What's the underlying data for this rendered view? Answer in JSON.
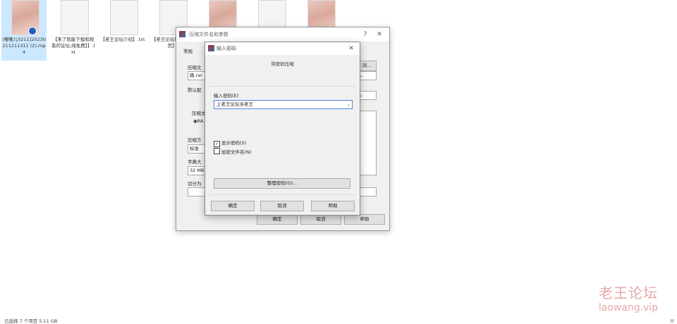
{
  "files": [
    {
      "name": "(嘟嘟儿0211]20230211211311 (2).mp4",
      "kind": "video",
      "selected": true
    },
    {
      "name": "【来了就能下载和观看的论坛,纯免费】】.txt",
      "kind": "text"
    },
    {
      "name": "【老王论坛介绍】.txt",
      "kind": "text"
    },
    {
      "name": "【老王论坛地址发布页】",
      "kind": "text"
    },
    {
      "name": "",
      "kind": "photo"
    },
    {
      "name": "",
      "kind": "text"
    },
    {
      "name": "",
      "kind": "photo"
    }
  ],
  "archive_dialog": {
    "title": "压缩文件名和参数",
    "help_glyph": "?",
    "close_glyph": "✕",
    "tab_general": "常规",
    "label_archive_name": "压缩文",
    "archive_name_value": "路.rar",
    "label_profile": "默认配",
    "label_format": "压缩文",
    "format_option": "RA",
    "label_method": "压缩方",
    "method_value": "标准",
    "label_dict": "字典大",
    "dict_value": "32 MB",
    "label_split": "切分为",
    "browse_label": "浏...",
    "ok": "确定",
    "cancel": "取消",
    "help": "帮助"
  },
  "password_dialog": {
    "title": "输入密码",
    "close_glyph": "✕",
    "group_title": "带密码压缩",
    "label_enter": "输入密码(E)",
    "password_value": "上老王论坛当老王",
    "show_password": {
      "label": "显示密码(S)",
      "checked": true
    },
    "encrypt_names": {
      "label": "加密文件名(N)",
      "checked": false
    },
    "organize_button": "整理密码(O)...",
    "ok": "确定",
    "cancel": "取消",
    "help": "帮助"
  },
  "status_bar": {
    "text": "已选择 7 个项目  5.11 GB"
  },
  "watermark": {
    "cn": "老王论坛",
    "en": "laowang.vip"
  },
  "colors": {
    "selection": "#cce8ff",
    "watermark": "#e7a9a9",
    "focus_border": "#4a86d6"
  }
}
